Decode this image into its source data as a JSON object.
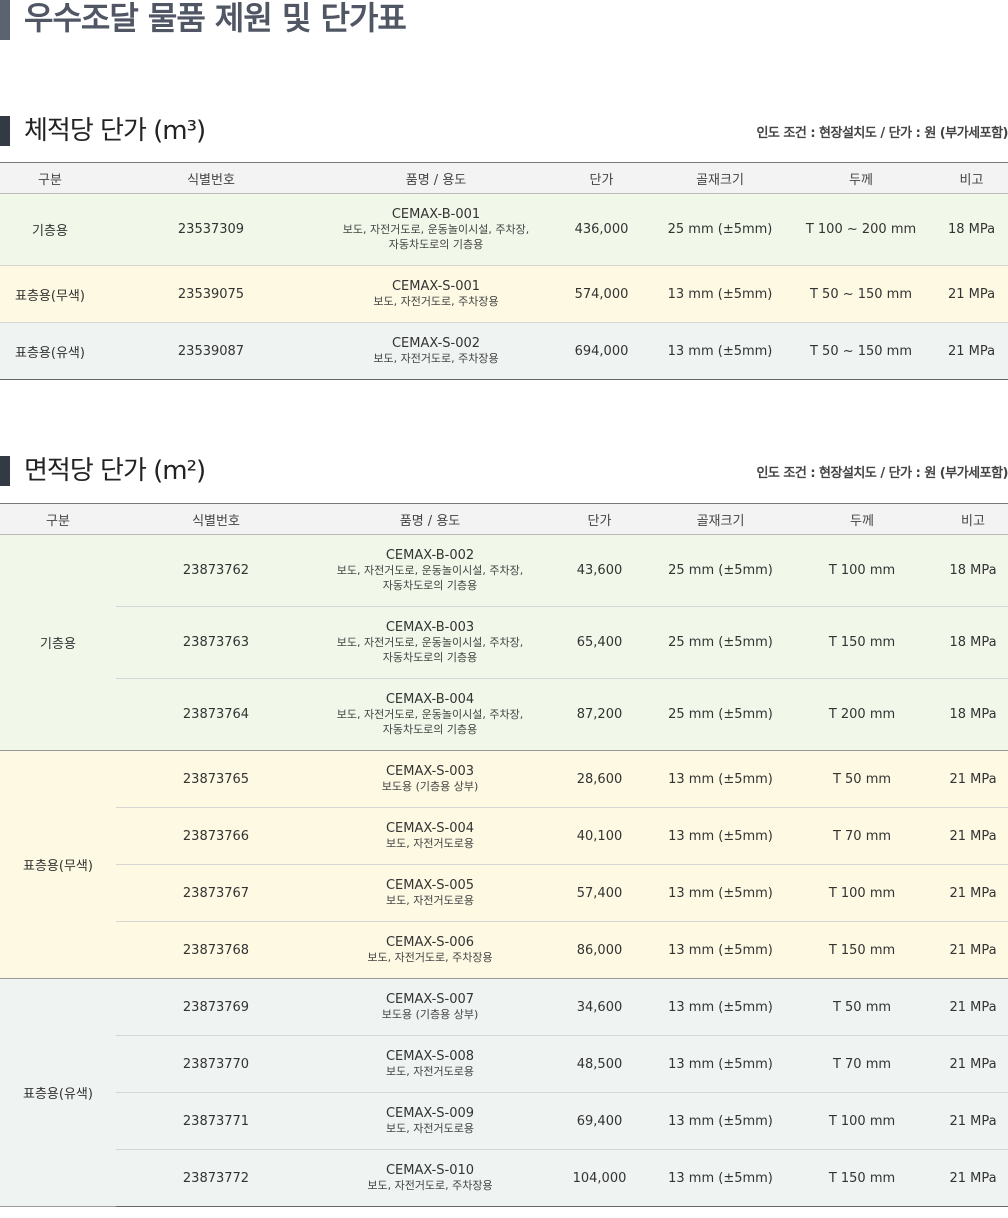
{
  "page": {
    "title": "우수조달 물품 제원 및 단가표"
  },
  "headers": [
    "구분",
    "식별번호",
    "품명 / 용도",
    "단가",
    "골재크기",
    "두께",
    "비고"
  ],
  "volume_section": {
    "title": "체적당 단가 (m³)",
    "note": "인도 조건 : 현장설치도 / 단가 : 원 (부가세포함)",
    "rows": [
      {
        "category": "기층용",
        "id": "23537309",
        "code": "CEMAX-B-001",
        "usage_lines": [
          "보도, 자전거도로, 운동놀이시설, 주차장,",
          "자동차도로의 기층용"
        ],
        "price": "436,000",
        "aggregate": "25 mm (±5mm)",
        "thickness": "T 100 ~ 200 mm",
        "note": "18 MPa"
      },
      {
        "category": "표층용(무색)",
        "id": "23539075",
        "code": "CEMAX-S-001",
        "usage_lines": [
          "보도, 자전거도로, 주차장용"
        ],
        "price": "574,000",
        "aggregate": "13 mm (±5mm)",
        "thickness": "T 50 ~ 150 mm",
        "note": "21 MPa"
      },
      {
        "category": "표층용(유색)",
        "id": "23539087",
        "code": "CEMAX-S-002",
        "usage_lines": [
          "보도, 자전거도로, 주차장용"
        ],
        "price": "694,000",
        "aggregate": "13 mm (±5mm)",
        "thickness": "T 50 ~ 150 mm",
        "note": "21 MPa"
      }
    ]
  },
  "area_section": {
    "title": "면적당 단가 (m²)",
    "note": "인도 조건 : 현장설치도 / 단가 : 원 (부가세포함)",
    "groups": [
      {
        "category": "기층용",
        "rows": [
          {
            "id": "23873762",
            "code": "CEMAX-B-002",
            "usage_lines": [
              "보도, 자전거도로, 운동놀이시설, 주차장,",
              "자동차도로의 기층용"
            ],
            "price": "43,600",
            "aggregate": "25 mm (±5mm)",
            "thickness": "T 100 mm",
            "note": "18 MPa"
          },
          {
            "id": "23873763",
            "code": "CEMAX-B-003",
            "usage_lines": [
              "보도, 자전거도로, 운동놀이시설, 주차장,",
              "자동차도로의 기층용"
            ],
            "price": "65,400",
            "aggregate": "25 mm (±5mm)",
            "thickness": "T 150 mm",
            "note": "18 MPa"
          },
          {
            "id": "23873764",
            "code": "CEMAX-B-004",
            "usage_lines": [
              "보도, 자전거도로, 운동놀이시설, 주차장,",
              "자동차도로의 기층용"
            ],
            "price": "87,200",
            "aggregate": "25 mm (±5mm)",
            "thickness": "T 200 mm",
            "note": "18 MPa"
          }
        ]
      },
      {
        "category": "표층용(무색)",
        "rows": [
          {
            "id": "23873765",
            "code": "CEMAX-S-003",
            "usage_lines": [
              "보도용 (기층용 상부)"
            ],
            "price": "28,600",
            "aggregate": "13 mm (±5mm)",
            "thickness": "T 50 mm",
            "note": "21 MPa"
          },
          {
            "id": "23873766",
            "code": "CEMAX-S-004",
            "usage_lines": [
              "보도, 자전거도로용"
            ],
            "price": "40,100",
            "aggregate": "13 mm (±5mm)",
            "thickness": "T 70 mm",
            "note": "21 MPa"
          },
          {
            "id": "23873767",
            "code": "CEMAX-S-005",
            "usage_lines": [
              "보도, 자전거도로용"
            ],
            "price": "57,400",
            "aggregate": "13 mm (±5mm)",
            "thickness": "T 100 mm",
            "note": "21 MPa"
          },
          {
            "id": "23873768",
            "code": "CEMAX-S-006",
            "usage_lines": [
              "보도, 자전거도로, 주차장용"
            ],
            "price": "86,000",
            "aggregate": "13 mm (±5mm)",
            "thickness": "T 150 mm",
            "note": "21 MPa"
          }
        ]
      },
      {
        "category": "표층용(유색)",
        "rows": [
          {
            "id": "23873769",
            "code": "CEMAX-S-007",
            "usage_lines": [
              "보도용 (기층용 상부)"
            ],
            "price": "34,600",
            "aggregate": "13 mm (±5mm)",
            "thickness": "T 50 mm",
            "note": "21 MPa"
          },
          {
            "id": "23873770",
            "code": "CEMAX-S-008",
            "usage_lines": [
              "보도, 자전거도로용"
            ],
            "price": "48,500",
            "aggregate": "13 mm (±5mm)",
            "thickness": "T 70 mm",
            "note": "21 MPa"
          },
          {
            "id": "23873771",
            "code": "CEMAX-S-009",
            "usage_lines": [
              "보도, 자전거도로용"
            ],
            "price": "69,400",
            "aggregate": "13 mm (±5mm)",
            "thickness": "T 100 mm",
            "note": "21 MPa"
          },
          {
            "id": "23873772",
            "code": "CEMAX-S-010",
            "usage_lines": [
              "보도, 자전거도로, 주차장용"
            ],
            "price": "104,000",
            "aggregate": "13 mm (±5mm)",
            "thickness": "T 150 mm",
            "note": "21 MPa"
          }
        ]
      }
    ]
  }
}
